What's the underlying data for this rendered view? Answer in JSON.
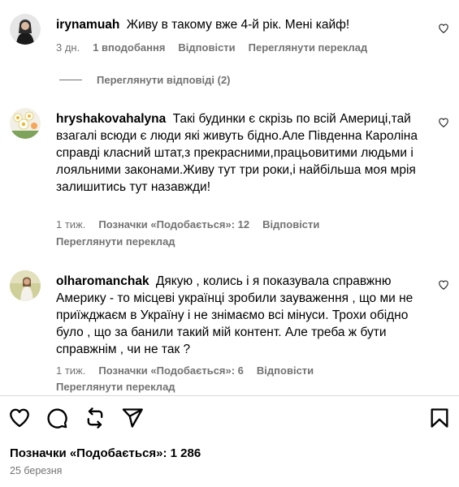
{
  "comments": [
    {
      "username": "irynamuah",
      "text": "Живу в такому вже 4-й рік. Мені кайф!",
      "time": "3 дн.",
      "likes": "1 вподобання",
      "reply": "Відповісти",
      "translate": "Переглянути переклад",
      "view_replies": "Переглянути відповіді (2)"
    },
    {
      "username": "hryshakovahalyna",
      "text": "Такі будинки є скрізь по всій Америці,тай взагалі всюди є люди які живуть бідно.Але Південна Кароліна справді класний штат,з прекрасними,працьовитими людьми і лояльними законами.Живу тут три роки,і найбільша моя мрія залишитись тут назавжди!",
      "time": "1 тиж.",
      "likes": "Позначки «Подобається»: 12",
      "reply": "Відповісти",
      "translate": "Переглянути переклад"
    },
    {
      "username": "olharomanchak",
      "text": "Дякую , колись і я показувала справжню Америку - то місцеві українці зробили зауваження , що ми не приїжджаєм в Україну і не знімаємо всі мінуси. Трохи обідно було , що за банили такий мій контент. Але треба ж бути справжнім , чи не так ?",
      "time": "1 тиж.",
      "likes": "Позначки «Подобається»: 6",
      "reply": "Відповісти",
      "translate": "Переглянути переклад"
    }
  ],
  "post": {
    "likes": "Позначки «Подобається»: 1 286",
    "date": "25 березня"
  },
  "icons": {
    "like": "heart-icon",
    "comment": "comment-bubble-icon",
    "share": "repost-icon",
    "send": "paper-plane-icon",
    "save": "bookmark-icon"
  }
}
